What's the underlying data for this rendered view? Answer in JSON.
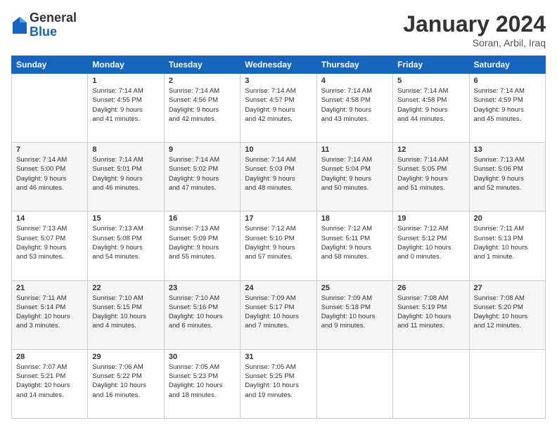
{
  "logo": {
    "general": "General",
    "blue": "Blue"
  },
  "header": {
    "title": "January 2024",
    "location": "Soran, Arbil, Iraq"
  },
  "weekdays": [
    "Sunday",
    "Monday",
    "Tuesday",
    "Wednesday",
    "Thursday",
    "Friday",
    "Saturday"
  ],
  "weeks": [
    [
      {
        "day": "",
        "info": ""
      },
      {
        "day": "1",
        "info": "Sunrise: 7:14 AM\nSunset: 4:55 PM\nDaylight: 9 hours\nand 41 minutes."
      },
      {
        "day": "2",
        "info": "Sunrise: 7:14 AM\nSunset: 4:56 PM\nDaylight: 9 hours\nand 42 minutes."
      },
      {
        "day": "3",
        "info": "Sunrise: 7:14 AM\nSunset: 4:57 PM\nDaylight: 9 hours\nand 42 minutes."
      },
      {
        "day": "4",
        "info": "Sunrise: 7:14 AM\nSunset: 4:58 PM\nDaylight: 9 hours\nand 43 minutes."
      },
      {
        "day": "5",
        "info": "Sunrise: 7:14 AM\nSunset: 4:58 PM\nDaylight: 9 hours\nand 44 minutes."
      },
      {
        "day": "6",
        "info": "Sunrise: 7:14 AM\nSunset: 4:59 PM\nDaylight: 9 hours\nand 45 minutes."
      }
    ],
    [
      {
        "day": "7",
        "info": "Sunrise: 7:14 AM\nSunset: 5:00 PM\nDaylight: 9 hours\nand 46 minutes."
      },
      {
        "day": "8",
        "info": "Sunrise: 7:14 AM\nSunset: 5:01 PM\nDaylight: 9 hours\nand 46 minutes."
      },
      {
        "day": "9",
        "info": "Sunrise: 7:14 AM\nSunset: 5:02 PM\nDaylight: 9 hours\nand 47 minutes."
      },
      {
        "day": "10",
        "info": "Sunrise: 7:14 AM\nSunset: 5:03 PM\nDaylight: 9 hours\nand 48 minutes."
      },
      {
        "day": "11",
        "info": "Sunrise: 7:14 AM\nSunset: 5:04 PM\nDaylight: 9 hours\nand 50 minutes."
      },
      {
        "day": "12",
        "info": "Sunrise: 7:14 AM\nSunset: 5:05 PM\nDaylight: 9 hours\nand 51 minutes."
      },
      {
        "day": "13",
        "info": "Sunrise: 7:13 AM\nSunset: 5:06 PM\nDaylight: 9 hours\nand 52 minutes."
      }
    ],
    [
      {
        "day": "14",
        "info": "Sunrise: 7:13 AM\nSunset: 5:07 PM\nDaylight: 9 hours\nand 53 minutes."
      },
      {
        "day": "15",
        "info": "Sunrise: 7:13 AM\nSunset: 5:08 PM\nDaylight: 9 hours\nand 54 minutes."
      },
      {
        "day": "16",
        "info": "Sunrise: 7:13 AM\nSunset: 5:09 PM\nDaylight: 9 hours\nand 55 minutes."
      },
      {
        "day": "17",
        "info": "Sunrise: 7:12 AM\nSunset: 5:10 PM\nDaylight: 9 hours\nand 57 minutes."
      },
      {
        "day": "18",
        "info": "Sunrise: 7:12 AM\nSunset: 5:11 PM\nDaylight: 9 hours\nand 58 minutes."
      },
      {
        "day": "19",
        "info": "Sunrise: 7:12 AM\nSunset: 5:12 PM\nDaylight: 10 hours\nand 0 minutes."
      },
      {
        "day": "20",
        "info": "Sunrise: 7:11 AM\nSunset: 5:13 PM\nDaylight: 10 hours\nand 1 minute."
      }
    ],
    [
      {
        "day": "21",
        "info": "Sunrise: 7:11 AM\nSunset: 5:14 PM\nDaylight: 10 hours\nand 3 minutes."
      },
      {
        "day": "22",
        "info": "Sunrise: 7:10 AM\nSunset: 5:15 PM\nDaylight: 10 hours\nand 4 minutes."
      },
      {
        "day": "23",
        "info": "Sunrise: 7:10 AM\nSunset: 5:16 PM\nDaylight: 10 hours\nand 6 minutes."
      },
      {
        "day": "24",
        "info": "Sunrise: 7:09 AM\nSunset: 5:17 PM\nDaylight: 10 hours\nand 7 minutes."
      },
      {
        "day": "25",
        "info": "Sunrise: 7:09 AM\nSunset: 5:18 PM\nDaylight: 10 hours\nand 9 minutes."
      },
      {
        "day": "26",
        "info": "Sunrise: 7:08 AM\nSunset: 5:19 PM\nDaylight: 10 hours\nand 11 minutes."
      },
      {
        "day": "27",
        "info": "Sunrise: 7:08 AM\nSunset: 5:20 PM\nDaylight: 10 hours\nand 12 minutes."
      }
    ],
    [
      {
        "day": "28",
        "info": "Sunrise: 7:07 AM\nSunset: 5:21 PM\nDaylight: 10 hours\nand 14 minutes."
      },
      {
        "day": "29",
        "info": "Sunrise: 7:06 AM\nSunset: 5:22 PM\nDaylight: 10 hours\nand 16 minutes."
      },
      {
        "day": "30",
        "info": "Sunrise: 7:05 AM\nSunset: 5:23 PM\nDaylight: 10 hours\nand 18 minutes."
      },
      {
        "day": "31",
        "info": "Sunrise: 7:05 AM\nSunset: 5:25 PM\nDaylight: 10 hours\nand 19 minutes."
      },
      {
        "day": "",
        "info": ""
      },
      {
        "day": "",
        "info": ""
      },
      {
        "day": "",
        "info": ""
      }
    ]
  ]
}
